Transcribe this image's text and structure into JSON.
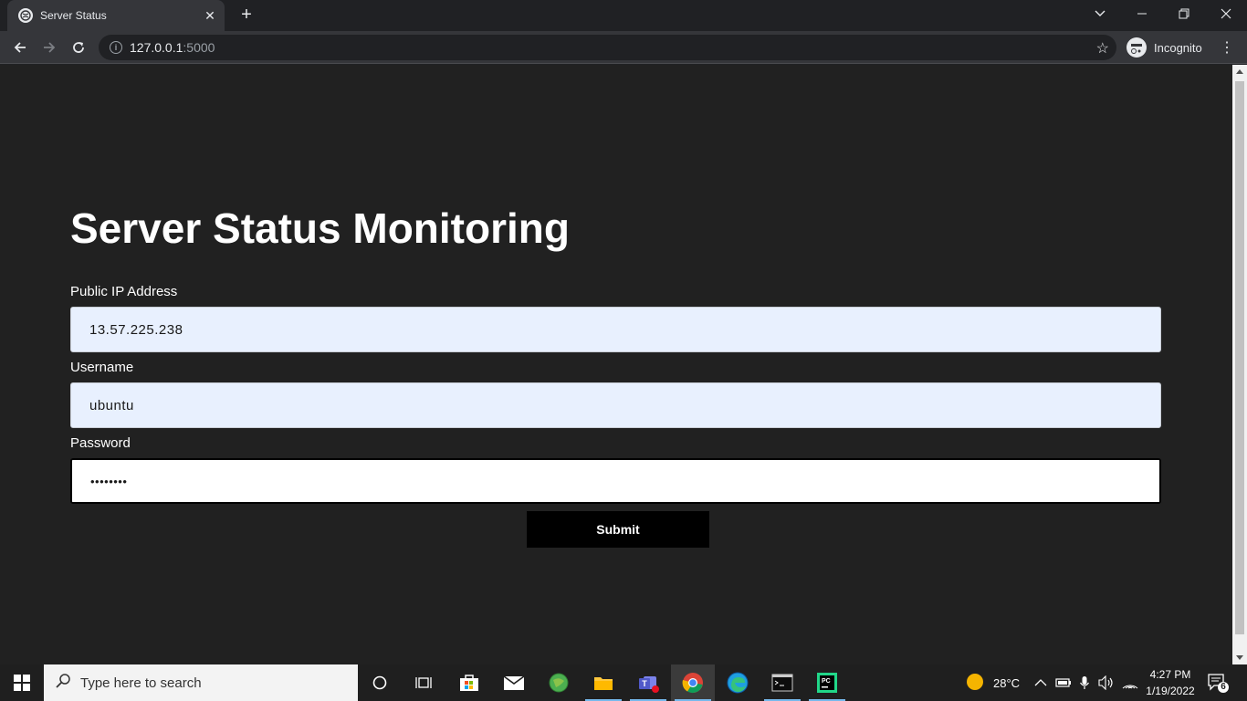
{
  "browser": {
    "tab_title": "Server Status",
    "url_host": "127.0.0.1",
    "url_port": ":5000",
    "profile_label": "Incognito"
  },
  "page": {
    "title": "Server Status Monitoring",
    "fields": {
      "ip_label": "Public IP Address",
      "ip_value": "13.57.225.238",
      "username_label": "Username",
      "username_value": "ubuntu",
      "password_label": "Password",
      "password_value": "••••••••"
    },
    "submit_label": "Submit"
  },
  "taskbar": {
    "search_placeholder": "Type here to search",
    "weather": "28°C",
    "time": "4:27 PM",
    "date": "1/19/2022",
    "notification_count": "6"
  }
}
